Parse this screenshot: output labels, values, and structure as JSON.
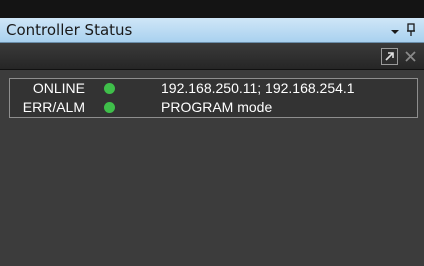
{
  "panel": {
    "title": "Controller Status"
  },
  "toolbar": {
    "popout_icon": "popout-icon",
    "close_icon": "close-icon"
  },
  "status": {
    "rows": [
      {
        "label": "ONLINE",
        "indicator_color": "#3fbf4a",
        "value": "192.168.250.11; 192.168.254.1"
      },
      {
        "label": "ERR/ALM",
        "indicator_color": "#3fbf4a",
        "value": "PROGRAM mode"
      }
    ]
  },
  "colors": {
    "title_bar": "#b7dbf3",
    "background": "#3c3c3c",
    "indicator_ok": "#3fbf4a"
  }
}
